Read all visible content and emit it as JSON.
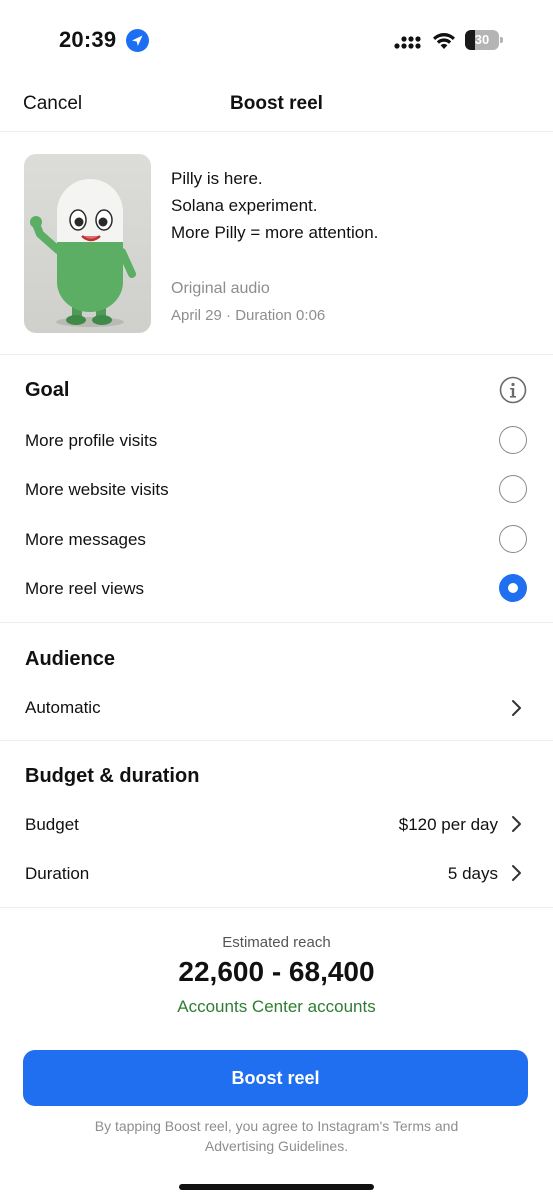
{
  "status_bar": {
    "time": "20:39",
    "battery_percent": 30,
    "battery_label": "30",
    "location_icon": "location-arrow-icon",
    "signal_icon": "cellular-signal-icon",
    "wifi_icon": "wifi-icon"
  },
  "header": {
    "cancel_label": "Cancel",
    "title": "Boost reel"
  },
  "post": {
    "thumbnail": "pill-character-thumbnail",
    "caption_lines": [
      "Pilly is here.",
      "Solana experiment.",
      "More Pilly = more attention."
    ],
    "audio": "Original audio",
    "meta": "April 29 · Duration 0:06"
  },
  "goal": {
    "title": "Goal",
    "info_icon": "info-icon",
    "options": [
      {
        "label": "More profile visits",
        "selected": false
      },
      {
        "label": "More website visits",
        "selected": false
      },
      {
        "label": "More messages",
        "selected": false
      },
      {
        "label": "More reel views",
        "selected": true
      }
    ]
  },
  "audience": {
    "title": "Audience",
    "value": "Automatic"
  },
  "budget_duration": {
    "title": "Budget & duration",
    "budget_label": "Budget",
    "budget_value": "$120 per day",
    "duration_label": "Duration",
    "duration_value": "5 days"
  },
  "reach": {
    "label": "Estimated reach",
    "value": "22,600 - 68,400",
    "note": "Accounts Center accounts"
  },
  "cta": {
    "boost_label": "Boost reel"
  },
  "legal": "By tapping Boost reel, you agree to Instagram's Terms and Advertising Guidelines.",
  "colors": {
    "accent": "#1f6ff0",
    "reach_note": "#2e7d32",
    "muted": "#8e8e8e"
  }
}
